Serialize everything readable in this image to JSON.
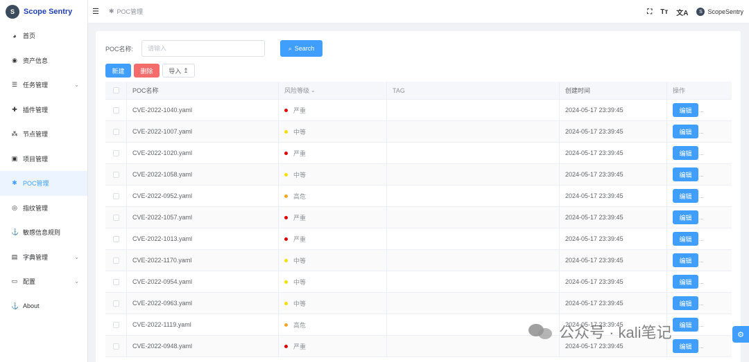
{
  "brand": {
    "name": "Scope Sentry",
    "logo_letter": "S"
  },
  "sidebar": {
    "items": [
      {
        "label": "首页",
        "icon": "dashboard-icon",
        "glyph": "◕",
        "has_children": false,
        "active": false
      },
      {
        "label": "资产信息",
        "icon": "eye-icon",
        "glyph": "◉",
        "has_children": false,
        "active": false
      },
      {
        "label": "任务管理",
        "icon": "list-icon",
        "glyph": "☰",
        "has_children": true,
        "active": false
      },
      {
        "label": "插件管理",
        "icon": "puzzle-icon",
        "glyph": "✚",
        "has_children": false,
        "active": false
      },
      {
        "label": "节点管理",
        "icon": "nodes-icon",
        "glyph": "⁂",
        "has_children": false,
        "active": false
      },
      {
        "label": "项目管理",
        "icon": "project-icon",
        "glyph": "▣",
        "has_children": false,
        "active": false
      },
      {
        "label": "POC管理",
        "icon": "bug-icon",
        "glyph": "✱",
        "has_children": false,
        "active": true
      },
      {
        "label": "指纹管理",
        "icon": "fingerprint-icon",
        "glyph": "◎",
        "has_children": false,
        "active": false
      },
      {
        "label": "敏感信息规则",
        "icon": "rule-icon",
        "glyph": "⚓",
        "has_children": false,
        "active": false
      },
      {
        "label": "字典管理",
        "icon": "book-icon",
        "glyph": "▤",
        "has_children": true,
        "active": false
      },
      {
        "label": "配置",
        "icon": "config-icon",
        "glyph": "▭",
        "has_children": true,
        "active": false
      },
      {
        "label": "About",
        "icon": "about-icon",
        "glyph": "⚓",
        "has_children": false,
        "active": false
      }
    ]
  },
  "header": {
    "breadcrumb": "POC管理",
    "user_name": "ScopeSentry",
    "icons": [
      "fullscreen-icon",
      "font-size-icon",
      "translate-icon"
    ]
  },
  "search": {
    "label": "POC名称:",
    "placeholder": "请输入",
    "button": "Search"
  },
  "actions": {
    "new": "新建",
    "delete": "删除",
    "import": "导入"
  },
  "table": {
    "headers": {
      "name": "POC名称",
      "level": "风险等级",
      "tag": "TAG",
      "time": "创建时间",
      "op": "操作"
    },
    "edit_label": "编辑",
    "more_label": "...",
    "rows": [
      {
        "name": "CVE-2022-1040.yaml",
        "level": "严重",
        "tag": "",
        "time": "2024-05-17 23:39:45"
      },
      {
        "name": "CVE-2022-1007.yaml",
        "level": "中等",
        "tag": "",
        "time": "2024-05-17 23:39:45"
      },
      {
        "name": "CVE-2022-1020.yaml",
        "level": "严重",
        "tag": "",
        "time": "2024-05-17 23:39:45"
      },
      {
        "name": "CVE-2022-1058.yaml",
        "level": "中等",
        "tag": "",
        "time": "2024-05-17 23:39:45"
      },
      {
        "name": "CVE-2022-0952.yaml",
        "level": "高危",
        "tag": "",
        "time": "2024-05-17 23:39:45"
      },
      {
        "name": "CVE-2022-1057.yaml",
        "level": "严重",
        "tag": "",
        "time": "2024-05-17 23:39:45"
      },
      {
        "name": "CVE-2022-1013.yaml",
        "level": "严重",
        "tag": "",
        "time": "2024-05-17 23:39:45"
      },
      {
        "name": "CVE-2022-1170.yaml",
        "level": "中等",
        "tag": "",
        "time": "2024-05-17 23:39:45"
      },
      {
        "name": "CVE-2022-0954.yaml",
        "level": "中等",
        "tag": "",
        "time": "2024-05-17 23:39:45"
      },
      {
        "name": "CVE-2022-0963.yaml",
        "level": "中等",
        "tag": "",
        "time": "2024-05-17 23:39:45"
      },
      {
        "name": "CVE-2022-1119.yaml",
        "level": "高危",
        "tag": "",
        "time": "2024-05-17 23:39:45"
      },
      {
        "name": "CVE-2022-0948.yaml",
        "level": "严重",
        "tag": "",
        "time": "2024-05-17 23:39:45"
      }
    ]
  },
  "level_colors": {
    "严重": "#e10000",
    "中等": "#f5e000",
    "高危": "#f5a623"
  },
  "colors": {
    "primary": "#409eff",
    "danger": "#f56c6c",
    "brand": "#1f3fae"
  },
  "watermark": {
    "text": "公众号 · kali笔记"
  }
}
